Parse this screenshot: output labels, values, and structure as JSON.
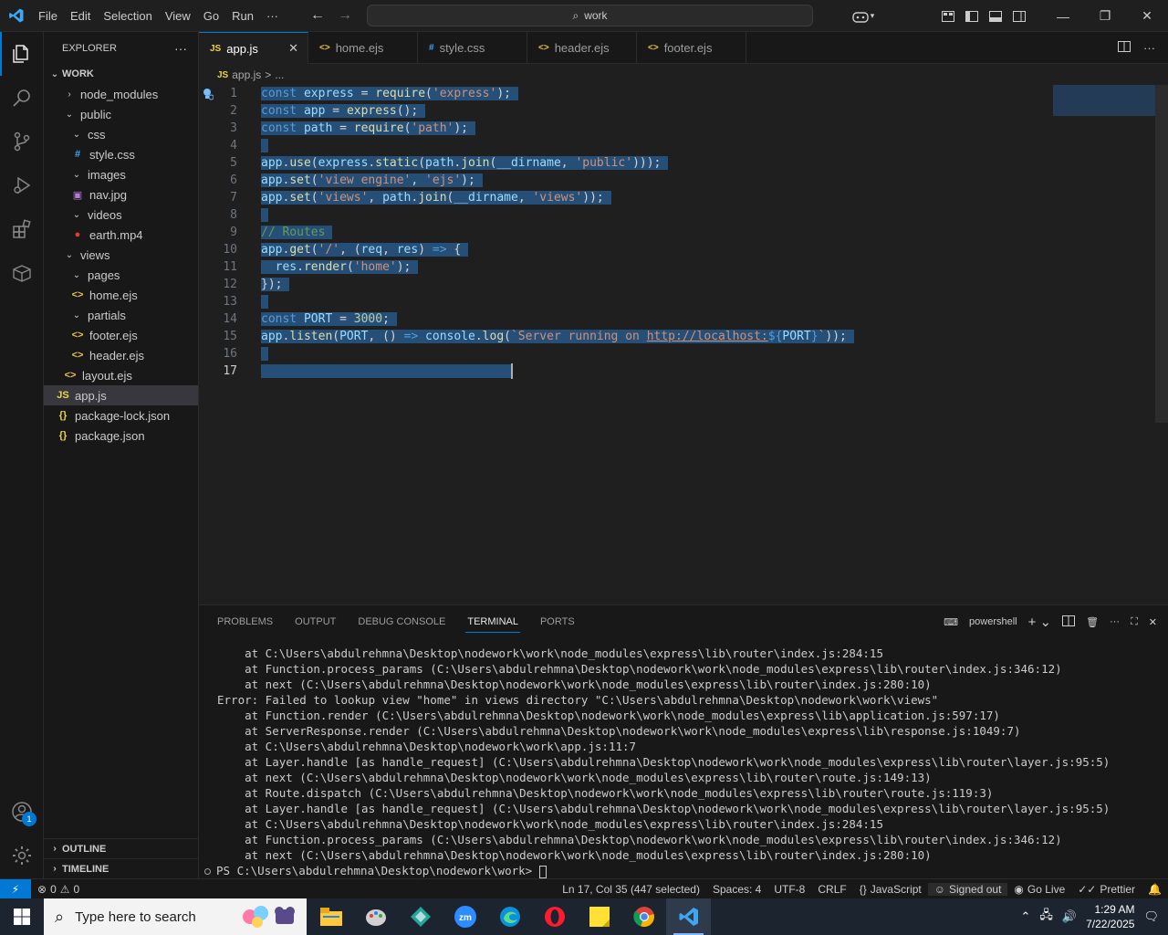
{
  "titlebar": {
    "menu": [
      "File",
      "Edit",
      "Selection",
      "View",
      "Go",
      "Run",
      "···"
    ],
    "search_text": "work"
  },
  "explorer": {
    "title": "EXPLORER",
    "more": "···",
    "root": "WORK",
    "items": [
      {
        "label": "node_modules",
        "indent": 1,
        "type": "folder",
        "open": false
      },
      {
        "label": "public",
        "indent": 1,
        "type": "folder",
        "open": true
      },
      {
        "label": "css",
        "indent": 2,
        "type": "folder",
        "open": true
      },
      {
        "label": "style.css",
        "indent": 3,
        "type": "css"
      },
      {
        "label": "images",
        "indent": 2,
        "type": "folder",
        "open": true
      },
      {
        "label": "nav.jpg",
        "indent": 3,
        "type": "img"
      },
      {
        "label": "videos",
        "indent": 2,
        "type": "folder",
        "open": true
      },
      {
        "label": "earth.mp4",
        "indent": 3,
        "type": "video"
      },
      {
        "label": "views",
        "indent": 1,
        "type": "folder",
        "open": true
      },
      {
        "label": "pages",
        "indent": 2,
        "type": "folder",
        "open": true
      },
      {
        "label": "home.ejs",
        "indent": 3,
        "type": "ejs"
      },
      {
        "label": "partials",
        "indent": 2,
        "type": "folder",
        "open": true
      },
      {
        "label": "footer.ejs",
        "indent": 3,
        "type": "ejs"
      },
      {
        "label": "header.ejs",
        "indent": 3,
        "type": "ejs"
      },
      {
        "label": "layout.ejs",
        "indent": 2,
        "type": "ejs"
      },
      {
        "label": "app.js",
        "indent": 1,
        "type": "js",
        "selected": true
      },
      {
        "label": "package-lock.json",
        "indent": 1,
        "type": "json"
      },
      {
        "label": "package.json",
        "indent": 1,
        "type": "json"
      }
    ],
    "outline": "OUTLINE",
    "timeline": "TIMELINE"
  },
  "tabs": [
    {
      "label": "app.js",
      "icon": "JS",
      "active": true
    },
    {
      "label": "home.ejs",
      "icon": "<>"
    },
    {
      "label": "style.css",
      "icon": "#"
    },
    {
      "label": "header.ejs",
      "icon": "<>"
    },
    {
      "label": "footer.ejs",
      "icon": "<>"
    }
  ],
  "breadcrumb": {
    "icon": "JS",
    "file": "app.js",
    "sep": ">",
    "more": "..."
  },
  "code_lines": [
    [
      [
        "kw",
        "const"
      ],
      [
        "pl",
        " "
      ],
      [
        "vr",
        "express"
      ],
      [
        "pl",
        " "
      ],
      [
        "op",
        "="
      ],
      [
        "pl",
        " "
      ],
      [
        "fn",
        "require"
      ],
      [
        "pl",
        "("
      ],
      [
        "st",
        "'express'"
      ],
      [
        "pl",
        ");"
      ]
    ],
    [
      [
        "kw",
        "const"
      ],
      [
        "pl",
        " "
      ],
      [
        "vr",
        "app"
      ],
      [
        "pl",
        " "
      ],
      [
        "op",
        "="
      ],
      [
        "pl",
        " "
      ],
      [
        "fn",
        "express"
      ],
      [
        "pl",
        "();"
      ]
    ],
    [
      [
        "kw",
        "const"
      ],
      [
        "pl",
        " "
      ],
      [
        "vr",
        "path"
      ],
      [
        "pl",
        " "
      ],
      [
        "op",
        "="
      ],
      [
        "pl",
        " "
      ],
      [
        "fn",
        "require"
      ],
      [
        "pl",
        "("
      ],
      [
        "st",
        "'path'"
      ],
      [
        "pl",
        ");"
      ]
    ],
    [],
    [
      [
        "vr",
        "app"
      ],
      [
        "pl",
        "."
      ],
      [
        "fn",
        "use"
      ],
      [
        "pl",
        "("
      ],
      [
        "vr",
        "express"
      ],
      [
        "pl",
        "."
      ],
      [
        "fn",
        "static"
      ],
      [
        "pl",
        "("
      ],
      [
        "vr",
        "path"
      ],
      [
        "pl",
        "."
      ],
      [
        "fn",
        "join"
      ],
      [
        "pl",
        "("
      ],
      [
        "vr",
        "__dirname"
      ],
      [
        "pl",
        ", "
      ],
      [
        "st",
        "'public'"
      ],
      [
        "pl",
        ")));"
      ]
    ],
    [
      [
        "vr",
        "app"
      ],
      [
        "pl",
        "."
      ],
      [
        "fn",
        "set"
      ],
      [
        "pl",
        "("
      ],
      [
        "st",
        "'view engine'"
      ],
      [
        "pl",
        ", "
      ],
      [
        "st",
        "'ejs'"
      ],
      [
        "pl",
        ");"
      ]
    ],
    [
      [
        "vr",
        "app"
      ],
      [
        "pl",
        "."
      ],
      [
        "fn",
        "set"
      ],
      [
        "pl",
        "("
      ],
      [
        "st",
        "'views'"
      ],
      [
        "pl",
        ", "
      ],
      [
        "vr",
        "path"
      ],
      [
        "pl",
        "."
      ],
      [
        "fn",
        "join"
      ],
      [
        "pl",
        "("
      ],
      [
        "vr",
        "__dirname"
      ],
      [
        "pl",
        ", "
      ],
      [
        "st",
        "'views'"
      ],
      [
        "pl",
        "));"
      ]
    ],
    [],
    [
      [
        "cm",
        "// Routes"
      ]
    ],
    [
      [
        "vr",
        "app"
      ],
      [
        "pl",
        "."
      ],
      [
        "fn",
        "get"
      ],
      [
        "pl",
        "("
      ],
      [
        "st",
        "'/'"
      ],
      [
        "pl",
        ", ("
      ],
      [
        "vr",
        "req"
      ],
      [
        "pl",
        ", "
      ],
      [
        "vr",
        "res"
      ],
      [
        "pl",
        ") "
      ],
      [
        "kw",
        "=>"
      ],
      [
        "pl",
        " {"
      ]
    ],
    [
      [
        "pl",
        "  "
      ],
      [
        "vr",
        "res"
      ],
      [
        "pl",
        "."
      ],
      [
        "fn",
        "render"
      ],
      [
        "pl",
        "("
      ],
      [
        "st",
        "'home'"
      ],
      [
        "pl",
        ");"
      ]
    ],
    [
      [
        "pl",
        "});"
      ]
    ],
    [],
    [
      [
        "kw",
        "const"
      ],
      [
        "pl",
        " "
      ],
      [
        "vr",
        "PORT"
      ],
      [
        "pl",
        " "
      ],
      [
        "op",
        "="
      ],
      [
        "pl",
        " "
      ],
      [
        "nm",
        "3000"
      ],
      [
        "pl",
        ";"
      ]
    ],
    [
      [
        "vr",
        "app"
      ],
      [
        "pl",
        "."
      ],
      [
        "fn",
        "listen"
      ],
      [
        "pl",
        "("
      ],
      [
        "vr",
        "PORT"
      ],
      [
        "pl",
        ", () "
      ],
      [
        "kw",
        "=>"
      ],
      [
        "pl",
        " "
      ],
      [
        "vr",
        "console"
      ],
      [
        "pl",
        "."
      ],
      [
        "fn",
        "log"
      ],
      [
        "pl",
        "("
      ],
      [
        "st",
        "`Server running on "
      ],
      [
        "stu",
        "http://localhost:"
      ],
      [
        "kw",
        "${"
      ],
      [
        "vr",
        "PORT"
      ],
      [
        "kw",
        "}"
      ],
      [
        "st",
        "`"
      ],
      [
        "pl",
        "));"
      ]
    ],
    [],
    [
      [
        "pl",
        "                                  "
      ]
    ]
  ],
  "panel": {
    "tabs": [
      "PROBLEMS",
      "OUTPUT",
      "DEBUG CONSOLE",
      "TERMINAL",
      "PORTS"
    ],
    "active_tab": "TERMINAL",
    "shell": "powershell",
    "lines": [
      "    at C:\\Users\\abdulrehmna\\Desktop\\nodework\\work\\node_modules\\express\\lib\\router\\index.js:284:15",
      "    at Function.process_params (C:\\Users\\abdulrehmna\\Desktop\\nodework\\work\\node_modules\\express\\lib\\router\\index.js:346:12)",
      "    at next (C:\\Users\\abdulrehmna\\Desktop\\nodework\\work\\node_modules\\express\\lib\\router\\index.js:280:10)",
      "Error: Failed to lookup view \"home\" in views directory \"C:\\Users\\abdulrehmna\\Desktop\\nodework\\work\\views\"",
      "    at Function.render (C:\\Users\\abdulrehmna\\Desktop\\nodework\\work\\node_modules\\express\\lib\\application.js:597:17)",
      "    at ServerResponse.render (C:\\Users\\abdulrehmna\\Desktop\\nodework\\work\\node_modules\\express\\lib\\response.js:1049:7)",
      "    at C:\\Users\\abdulrehmna\\Desktop\\nodework\\work\\app.js:11:7",
      "    at Layer.handle [as handle_request] (C:\\Users\\abdulrehmna\\Desktop\\nodework\\work\\node_modules\\express\\lib\\router\\layer.js:95:5)",
      "    at next (C:\\Users\\abdulrehmna\\Desktop\\nodework\\work\\node_modules\\express\\lib\\router\\route.js:149:13)",
      "    at Route.dispatch (C:\\Users\\abdulrehmna\\Desktop\\nodework\\work\\node_modules\\express\\lib\\router\\route.js:119:3)",
      "    at Layer.handle [as handle_request] (C:\\Users\\abdulrehmna\\Desktop\\nodework\\work\\node_modules\\express\\lib\\router\\layer.js:95:5)",
      "    at C:\\Users\\abdulrehmna\\Desktop\\nodework\\work\\node_modules\\express\\lib\\router\\index.js:284:15",
      "    at Function.process_params (C:\\Users\\abdulrehmna\\Desktop\\nodework\\work\\node_modules\\express\\lib\\router\\index.js:346:12)",
      "    at next (C:\\Users\\abdulrehmna\\Desktop\\nodework\\work\\node_modules\\express\\lib\\router\\index.js:280:10)"
    ],
    "prompt": "PS C:\\Users\\abdulrehmna\\Desktop\\nodework\\work> "
  },
  "statusbar": {
    "problems": "0",
    "warnings": "0",
    "position": "Ln 17, Col 35 (447 selected)",
    "spaces": "Spaces: 4",
    "encoding": "UTF-8",
    "eol": "CRLF",
    "language": "JavaScript",
    "account": "Signed out",
    "golive": "Go Live",
    "prettier": "Prettier"
  },
  "taskbar": {
    "search_placeholder": "Type here to search",
    "time": "1:29 AM",
    "date": "7/22/2025"
  },
  "accounts_badge": "1",
  "colors": {
    "accent": "#0078d4",
    "selection": "#264f78",
    "js_icon": "#e8d44d",
    "ejs_icon": "#e8c04d",
    "css_icon": "#42a5f5",
    "json_icon": "#e8d44d"
  }
}
